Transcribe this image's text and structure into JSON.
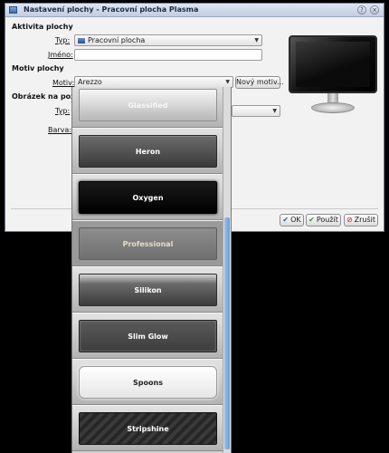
{
  "window": {
    "title": "Nastavení plochy - Pracovní plocha Plasma"
  },
  "desktop_activity": {
    "heading": "Aktivita plochy",
    "type_label": "Typ:",
    "type_value": "Pracovní plocha",
    "name_label": "Jméno:",
    "name_value": ""
  },
  "theme": {
    "heading": "Motiv plochy",
    "theme_label": "Motiv:",
    "theme_value": "Arezzo",
    "new_theme_button": "Nový motiv..."
  },
  "wallpaper": {
    "heading": "Obrázek na pozad",
    "type_label": "Typ:",
    "color_label": "Barva:"
  },
  "buttons": {
    "ok": "OK",
    "apply": "Použít",
    "cancel": "Zrušit"
  },
  "theme_list": [
    {
      "label": "Glassified",
      "style": "glass"
    },
    {
      "label": "Heron",
      "style": "dark-gray"
    },
    {
      "label": "Oxygen",
      "style": "black"
    },
    {
      "label": "Professional",
      "style": "professional"
    },
    {
      "label": "Silikon",
      "style": "silikon"
    },
    {
      "label": "Slim Glow",
      "style": "slim"
    },
    {
      "label": "Spoons",
      "style": "white"
    },
    {
      "label": "Stripshine",
      "style": "stripe"
    }
  ],
  "colors": {
    "titlebar": "#c2cde0",
    "scroll_thumb": "#6a9ad6",
    "window_bg": "#f2f2f2"
  }
}
